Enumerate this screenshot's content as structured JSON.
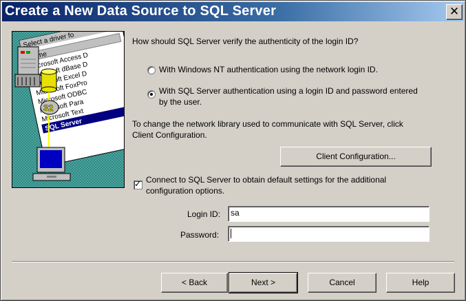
{
  "window": {
    "title": "Create a New Data Source to SQL Server",
    "close_glyph": "✕"
  },
  "illustration": {
    "list_header": "Select a driver fo",
    "column_label": "Name",
    "drivers": [
      "Microsoft Access D",
      "Microsoft dBase D",
      "Microsoft Excel D",
      "Microsoft FoxPro",
      "Microsoft ODBC",
      "Microsoft Para",
      "Microsoft Text",
      "SQL Server"
    ],
    "badge": "32"
  },
  "auth": {
    "question": "How should SQL Server verify the authenticity of the login ID?",
    "option_nt": "With Windows NT authentication using the network login ID.",
    "option_sql_line1": "With SQL Server authentication using a login ID and password entered",
    "option_sql_line2": "by the user.",
    "selected": "sql"
  },
  "network": {
    "info_line1": "To change the network library used to communicate with SQL Server, click",
    "info_line2": "Client Configuration.",
    "client_config_label": "Client Configuration..."
  },
  "connect": {
    "checked": true,
    "label_line1": "Connect to SQL Server to obtain default settings for the additional",
    "label_line2": "configuration options."
  },
  "login": {
    "login_label": "Login ID:",
    "login_value": "sa",
    "password_label": "Password:",
    "password_value": ""
  },
  "buttons": {
    "back": "< Back",
    "next": "Next >",
    "cancel": "Cancel",
    "help": "Help"
  }
}
